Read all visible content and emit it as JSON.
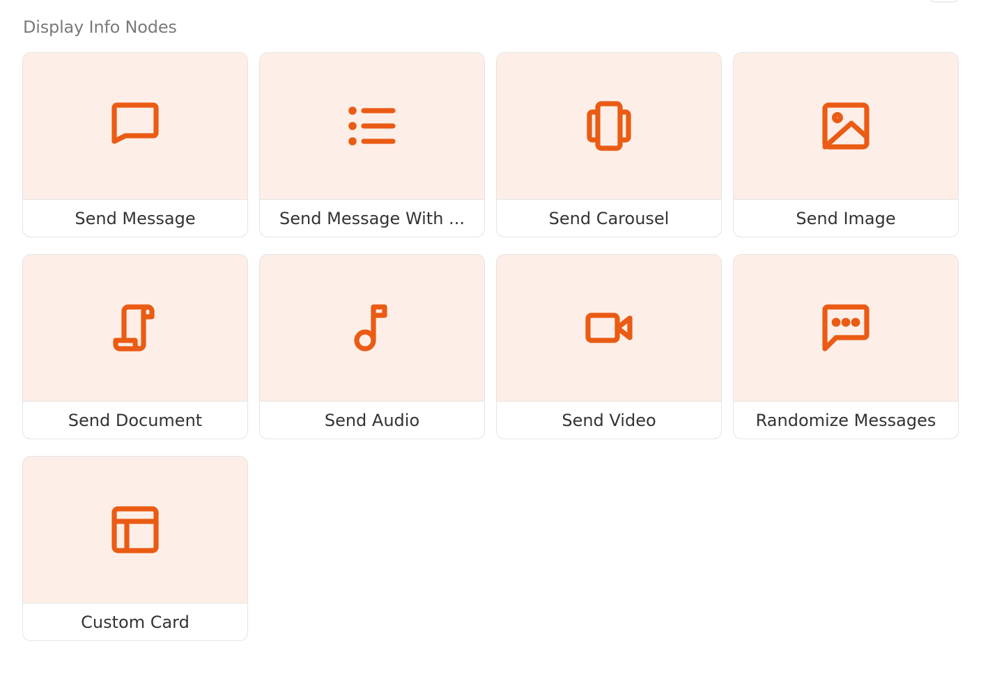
{
  "section": {
    "title": "Display Info Nodes"
  },
  "accent_color": "#ea5b14",
  "cards": [
    {
      "label": "Send Message",
      "icon": "message-square-icon"
    },
    {
      "label": "Send Message With ...",
      "icon": "list-icon"
    },
    {
      "label": "Send Carousel",
      "icon": "carousel-icon"
    },
    {
      "label": "Send Image",
      "icon": "image-icon"
    },
    {
      "label": "Send Document",
      "icon": "scroll-document-icon"
    },
    {
      "label": "Send Audio",
      "icon": "music-note-icon"
    },
    {
      "label": "Send Video",
      "icon": "video-camera-icon"
    },
    {
      "label": "Randomize Messages",
      "icon": "message-dots-icon"
    },
    {
      "label": "Custom Card",
      "icon": "layout-icon"
    }
  ]
}
